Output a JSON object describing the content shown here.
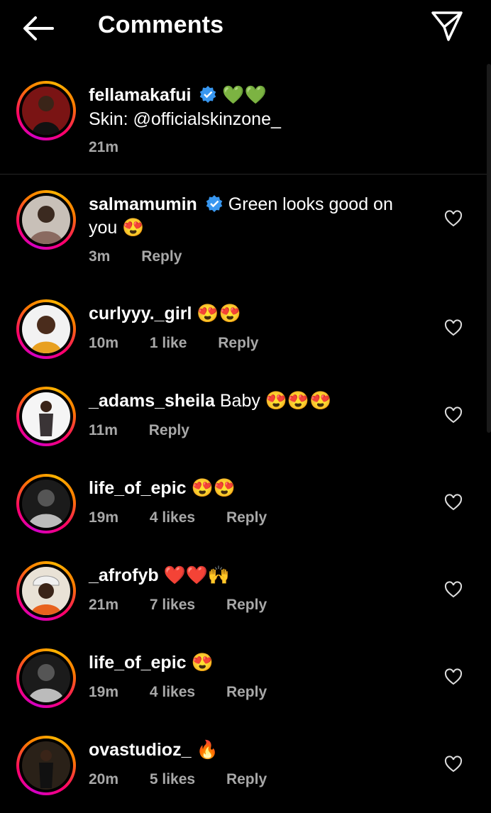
{
  "header": {
    "title": "Comments",
    "back_icon": "arrow-left-icon",
    "share_icon": "paper-plane-icon"
  },
  "caption": {
    "username": "fellamakafui",
    "verified": true,
    "emojis": "💚💚",
    "text": "Skin: @officialskinzone_",
    "time": "21m"
  },
  "comments": [
    {
      "username": "salmamumin",
      "verified": true,
      "text": "Green looks good on",
      "text2": "you 😍",
      "time": "3m",
      "likes": "",
      "reply": "Reply"
    },
    {
      "username": "curlyyy._girl",
      "verified": false,
      "text": "😍😍",
      "time": "10m",
      "likes": "1 like",
      "reply": "Reply"
    },
    {
      "username": "_adams_sheila",
      "verified": false,
      "text": "Baby 😍😍😍",
      "time": "11m",
      "likes": "",
      "reply": "Reply"
    },
    {
      "username": "life_of_epic",
      "verified": false,
      "text": "😍😍",
      "time": "19m",
      "likes": "4 likes",
      "reply": "Reply"
    },
    {
      "username": "_afrofyb",
      "verified": false,
      "text": "❤️❤️🙌",
      "time": "21m",
      "likes": "7 likes",
      "reply": "Reply"
    },
    {
      "username": "life_of_epic",
      "verified": false,
      "text": "😍",
      "time": "19m",
      "likes": "4 likes",
      "reply": "Reply"
    },
    {
      "username": "ovastudioz_",
      "verified": false,
      "text": "🔥",
      "time": "20m",
      "likes": "5 likes",
      "reply": "Reply"
    }
  ],
  "colors": {
    "background": "#000000",
    "meta": "#a8a8a8",
    "verified": "#3897f0"
  }
}
